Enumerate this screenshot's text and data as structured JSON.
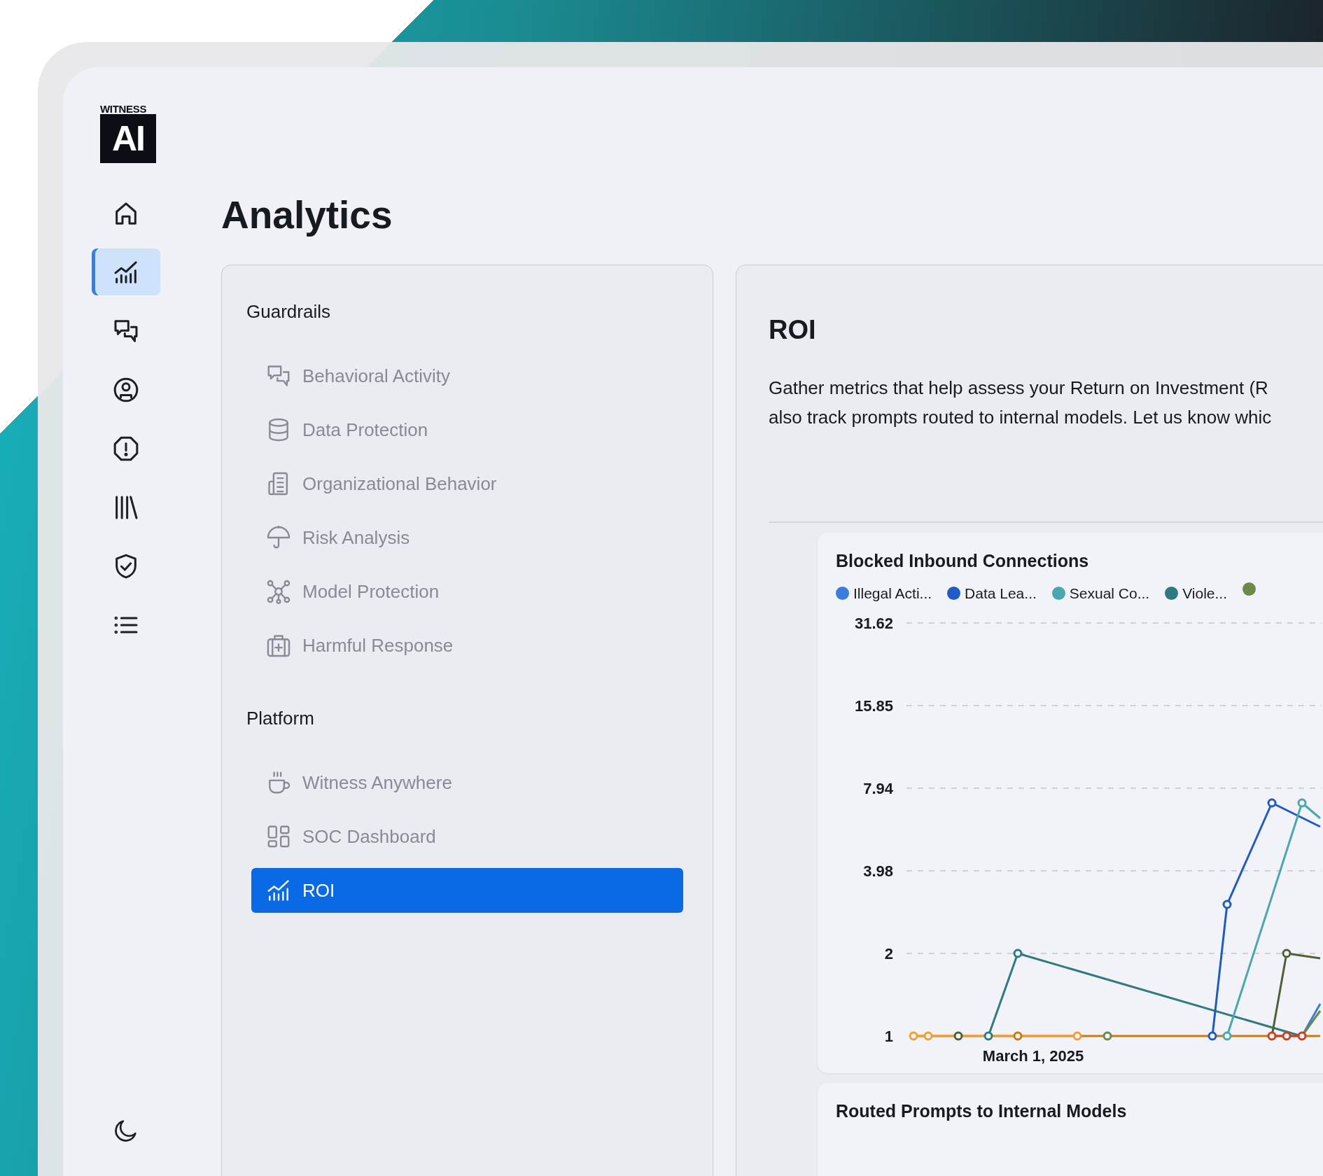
{
  "logo": {
    "wordmark": "WITNESS",
    "mark": "AI"
  },
  "sidebar": {
    "items": [
      {
        "selected": false
      },
      {
        "selected": true
      },
      {
        "selected": false
      },
      {
        "selected": false
      },
      {
        "selected": false
      },
      {
        "selected": false
      },
      {
        "selected": false
      },
      {
        "selected": false
      }
    ]
  },
  "page_title": "Analytics",
  "nav_panel": {
    "sections": [
      {
        "heading": "Guardrails",
        "items": [
          {
            "label": "Behavioral Activity",
            "selected": false
          },
          {
            "label": "Data Protection",
            "selected": false
          },
          {
            "label": "Organizational Behavior",
            "selected": false
          },
          {
            "label": "Risk Analysis",
            "selected": false
          },
          {
            "label": "Model Protection",
            "selected": false
          },
          {
            "label": "Harmful Response",
            "selected": false
          }
        ]
      },
      {
        "heading": "Platform",
        "items": [
          {
            "label": "Witness Anywhere",
            "selected": false
          },
          {
            "label": "SOC Dashboard",
            "selected": false
          },
          {
            "label": "ROI",
            "selected": true
          }
        ]
      }
    ]
  },
  "content": {
    "title": "ROI",
    "description_lines": [
      "Gather metrics that help assess your Return on Investment (R",
      "also track prompts routed to internal models. Let us know whic"
    ],
    "cards": [
      {
        "title": "Blocked Inbound Connections",
        "legend": [
          {
            "label": "Illegal Acti...",
            "color": "#3b7ddd"
          },
          {
            "label": "Data Lea...",
            "color": "#1f5bc4"
          },
          {
            "label": "Sexual Co...",
            "color": "#4aa8ad"
          },
          {
            "label": "Viole...",
            "color": "#2f7a7e"
          },
          {
            "color": "#6b8a4a"
          }
        ],
        "y_ticks": [
          "31.62",
          "15.85",
          "7.94",
          "3.98",
          "2",
          "1"
        ],
        "x_label": "March 1, 2025"
      },
      {
        "title": "Routed Prompts to Internal Models"
      }
    ]
  }
}
